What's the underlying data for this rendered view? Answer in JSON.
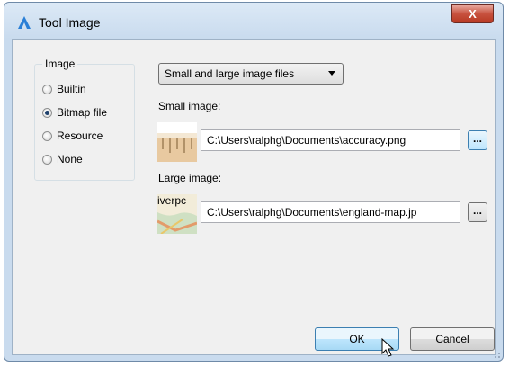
{
  "window": {
    "title": "Tool Image",
    "close_label": "X"
  },
  "image_group": {
    "legend": "Image",
    "options": [
      {
        "label": "Builtin",
        "checked": false
      },
      {
        "label": "Bitmap file",
        "checked": true
      },
      {
        "label": "Resource",
        "checked": false
      },
      {
        "label": "None",
        "checked": false
      }
    ]
  },
  "dropdown": {
    "selected": "Small and large image files"
  },
  "small_image": {
    "label": "Small image:",
    "path": "C:\\Users\\ralphg\\Documents\\accuracy.png",
    "browse_label": "..."
  },
  "large_image": {
    "label": "Large image:",
    "path": "C:\\Users\\ralphg\\Documents\\england-map.jp",
    "thumb_text": "iverpc",
    "browse_label": "..."
  },
  "buttons": {
    "ok": "OK",
    "cancel": "Cancel"
  },
  "icons": {
    "app": "bricscad-arrow-icon",
    "cursor": "mouse-pointer-icon"
  }
}
